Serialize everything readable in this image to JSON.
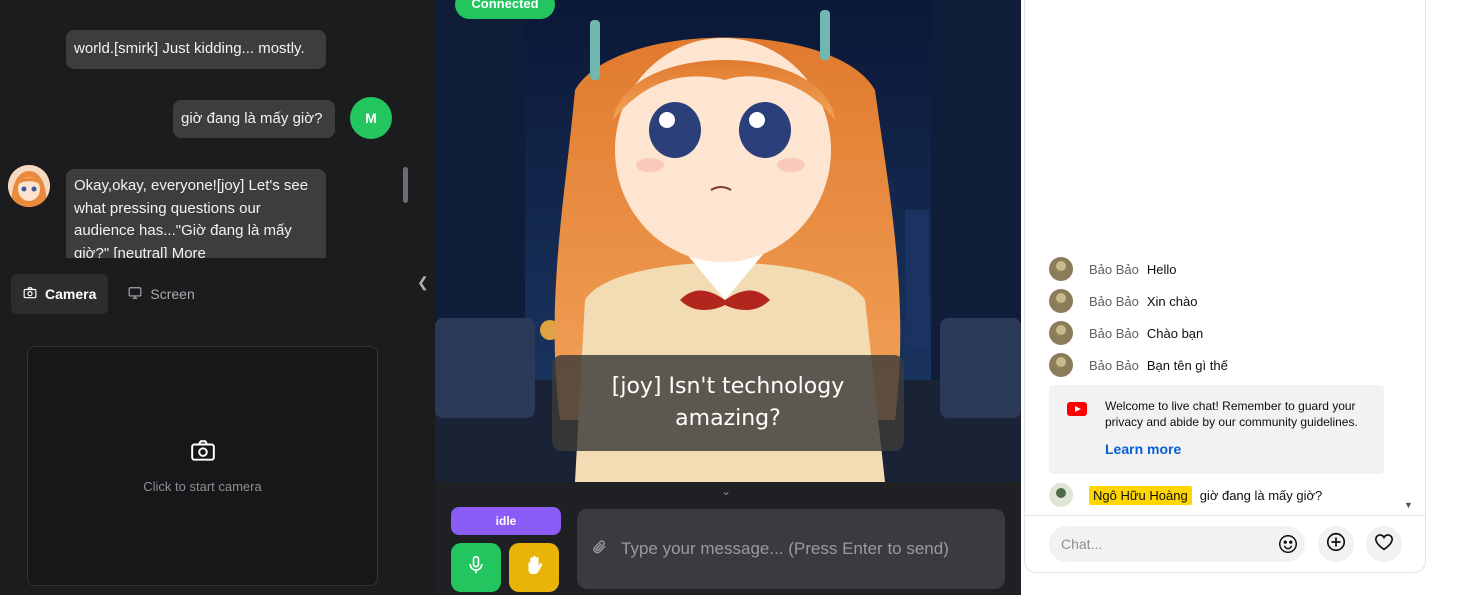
{
  "chat": {
    "messages": [
      {
        "sender": "ai",
        "text": "world.[smirk] Just kidding... mostly."
      },
      {
        "sender": "user",
        "text": "giờ đang là mấy giờ?",
        "avatar_letter": "M"
      },
      {
        "sender": "ai",
        "text": "Okay,okay, everyone![joy] Let's see\nwhat pressing questions our\naudience has...\"Giờ đang là mấy\ngiờ?\" [neutral] More"
      }
    ]
  },
  "tabs": [
    {
      "label": "Camera",
      "icon": "camera-icon",
      "active": true
    },
    {
      "label": "Screen",
      "icon": "monitor-icon",
      "active": false
    }
  ],
  "camera": {
    "prompt": "Click to start camera"
  },
  "stage": {
    "status": "Connected",
    "subtitle": "[joy] Isn't technology amazing?"
  },
  "controls": {
    "state": "idle",
    "input_placeholder": "Type your message... (Press Enter to send)"
  },
  "live_chat": {
    "messages": [
      {
        "author": "Bảo Bảo",
        "text": "Hello"
      },
      {
        "author": "Bảo Bảo",
        "text": "Xin chào"
      },
      {
        "author": "Bảo Bảo",
        "text": "Chào bạn"
      },
      {
        "author": "Bảo Bảo",
        "text": "Bạn tên gì thế"
      }
    ],
    "welcome": {
      "text": "Welcome to live chat! Remember to guard your privacy and abide by our community guidelines.",
      "link": "Learn more"
    },
    "last_message": {
      "author": "Ngô Hữu Hoàng",
      "text": "giờ đang là mấy giờ?"
    },
    "input_placeholder": "Chat..."
  },
  "colors": {
    "accent_green": "#22c55e",
    "idle_purple": "#8b5cf6",
    "hand_yellow": "#eab308",
    "youtube_red": "#ff0000",
    "member_badge": "#ffd600"
  }
}
